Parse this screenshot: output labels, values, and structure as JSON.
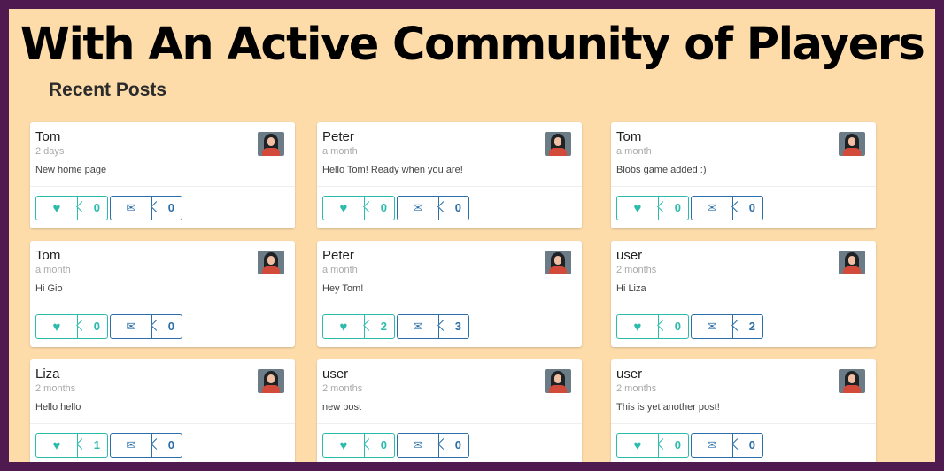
{
  "headline": "With An Active Community of Players",
  "section_title": "Recent Posts",
  "posts": [
    {
      "author": "Tom",
      "time": "2 days",
      "text": "New home page",
      "likes": "0",
      "comments": "0"
    },
    {
      "author": "Peter",
      "time": "a month",
      "text": "Hello Tom! Ready when you are!",
      "likes": "0",
      "comments": "0"
    },
    {
      "author": "Tom",
      "time": "a month",
      "text": "Blobs game added :)",
      "likes": "0",
      "comments": "0"
    },
    {
      "author": "Tom",
      "time": "a month",
      "text": "Hi Gio",
      "likes": "0",
      "comments": "0"
    },
    {
      "author": "Peter",
      "time": "a month",
      "text": "Hey Tom!",
      "likes": "2",
      "comments": "3"
    },
    {
      "author": "user",
      "time": "2 months",
      "text": "Hi Liza",
      "likes": "0",
      "comments": "2"
    },
    {
      "author": "Liza",
      "time": "2 months",
      "text": "Hello hello",
      "likes": "1",
      "comments": "0"
    },
    {
      "author": "user",
      "time": "2 months",
      "text": "new post",
      "likes": "0",
      "comments": "0"
    },
    {
      "author": "user",
      "time": "2 months",
      "text": "This is yet another post!",
      "likes": "0",
      "comments": "0"
    }
  ],
  "icons": {
    "like": "heart-icon",
    "comment": "comments-icon"
  },
  "colors": {
    "frame": "#4e1a4f",
    "background": "#fddcaa",
    "like": "#2bbbad",
    "comment": "#2b6ea8"
  }
}
